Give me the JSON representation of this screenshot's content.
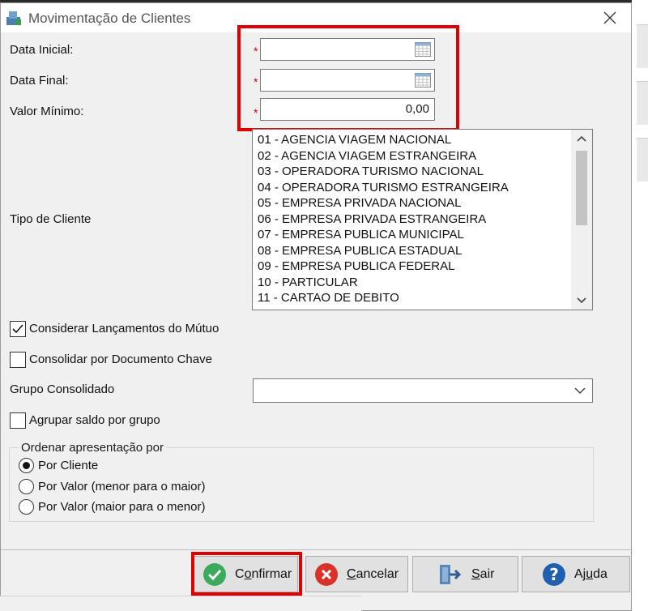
{
  "window": {
    "title": "Movimentação de Clientes"
  },
  "fields": {
    "data_inicial": {
      "label": "Data Inicial:",
      "value": ""
    },
    "data_final": {
      "label": "Data Final:",
      "value": ""
    },
    "valor_minimo": {
      "label": "Valor Mínimo:",
      "value": "0,00"
    },
    "required_mark": "*"
  },
  "tipo_cliente": {
    "label": "Tipo de Cliente",
    "items": [
      "01 - AGENCIA VIAGEM NACIONAL",
      "02 - AGENCIA VIAGEM ESTRANGEIRA",
      "03 - OPERADORA TURISMO NACIONAL",
      "04 - OPERADORA TURISMO ESTRANGEIRA",
      "05 - EMPRESA PRIVADA NACIONAL",
      "06 - EMPRESA PRIVADA ESTRANGEIRA",
      "07 - EMPRESA PUBLICA MUNICIPAL",
      "08 - EMPRESA PUBLICA ESTADUAL",
      "09 - EMPRESA PUBLICA FEDERAL",
      "10 - PARTICULAR",
      "11 - CARTAO DE DEBITO"
    ]
  },
  "options": {
    "considerar_mutuo": {
      "label": "Considerar Lançamentos do Mútuo",
      "checked": true
    },
    "consolidar_doc": {
      "label": "Consolidar por Documento Chave",
      "checked": false
    },
    "grupo_consolidado": {
      "label": "Grupo Consolidado",
      "value": ""
    },
    "agrupar_saldo": {
      "label": "Agrupar saldo por grupo",
      "checked": false
    }
  },
  "ordenar": {
    "title": "Ordenar apresentação por",
    "options": [
      {
        "label": "Por Cliente",
        "selected": true
      },
      {
        "label": "Por Valor (menor para o maior)",
        "selected": false
      },
      {
        "label": "Por Valor (maior para o menor)",
        "selected": false
      }
    ]
  },
  "buttons": {
    "confirmar": {
      "prefix": "C",
      "underline": "o",
      "rest": "nfirmar"
    },
    "cancelar": {
      "prefix": "",
      "underline": "C",
      "rest": "ancelar"
    },
    "sair": {
      "prefix": "",
      "underline": "S",
      "rest": "air"
    },
    "ajuda": {
      "prefix": "Aj",
      "underline": "u",
      "rest": "da"
    }
  },
  "colors": {
    "highlight": "#e00000",
    "required": "#d20000",
    "confirm_icon": "#3aaa5c",
    "cancel_icon": "#d8332a",
    "help_icon": "#1f5fb0"
  }
}
